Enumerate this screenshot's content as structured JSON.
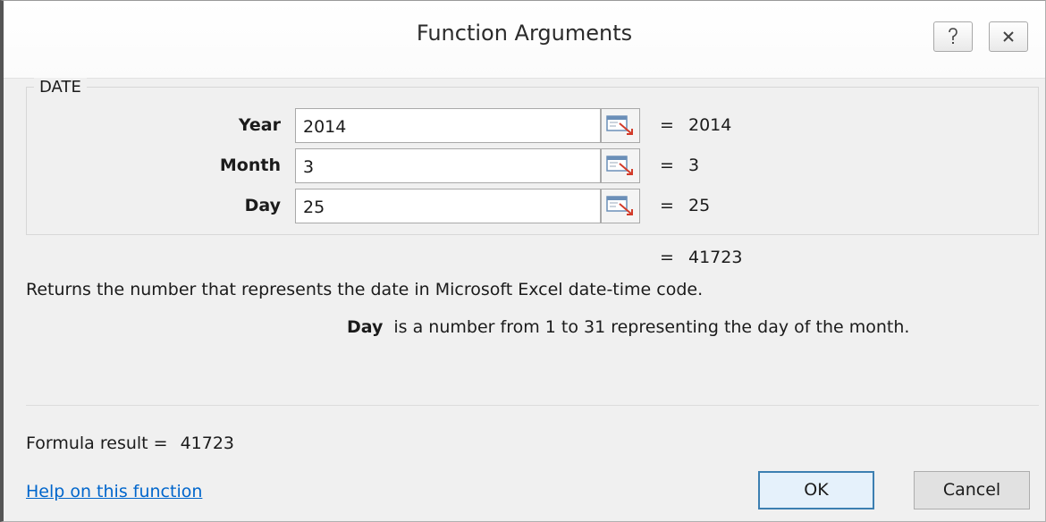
{
  "dialog": {
    "title": "Function Arguments"
  },
  "function_group": {
    "name": "DATE",
    "args": [
      {
        "label": "Year",
        "value": "2014",
        "evaluated": "2014"
      },
      {
        "label": "Month",
        "value": "3",
        "evaluated": "3"
      },
      {
        "label": "Day",
        "value": "25",
        "evaluated": "25"
      }
    ],
    "equals": "="
  },
  "result": {
    "equals": "=",
    "value": "41723"
  },
  "description": "Returns the number that represents the date in Microsoft Excel date-time code.",
  "arg_description": {
    "name": "Day",
    "text": "is a number from 1 to 31 representing the day of the month."
  },
  "formula_result": {
    "label": "Formula result =",
    "value": "41723"
  },
  "help_link": "Help on this function",
  "buttons": {
    "ok": "OK",
    "cancel": "Cancel"
  },
  "icons": {
    "help": "help-question-icon",
    "close": "close-icon",
    "collapse": "collapse-dialog-icon"
  }
}
